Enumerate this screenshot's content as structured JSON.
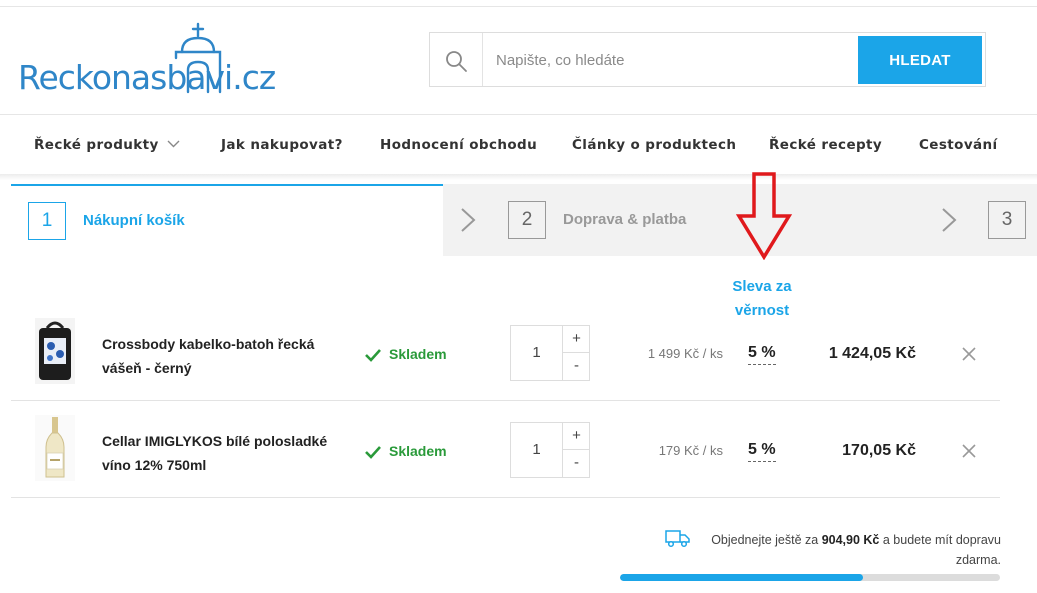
{
  "header": {
    "logo_text": "Reckonasbavi.cz",
    "search": {
      "placeholder": "Napište, co hledáte",
      "button_label": "HLEDAT"
    }
  },
  "nav": {
    "items": [
      {
        "label": "Řecké produkty",
        "has_dropdown": true
      },
      {
        "label": "Jak nakupovat?"
      },
      {
        "label": "Hodnocení obchodu"
      },
      {
        "label": "Články o produktech"
      },
      {
        "label": "Řecké recepty"
      },
      {
        "label": "Cestování"
      }
    ]
  },
  "steps": [
    {
      "number": "1",
      "label": "Nákupní košík",
      "active": true
    },
    {
      "number": "2",
      "label": "Doprava & platba",
      "active": false
    },
    {
      "number": "3",
      "label": "",
      "active": false
    }
  ],
  "cart": {
    "loyalty_header_line1": "Sleva za",
    "loyalty_header_line2": "věrnost",
    "items": [
      {
        "name": "Crossbody kabelko-batoh řecká vášeň - černý",
        "stock": "Skladem",
        "quantity": "1",
        "unit_price": "1 499 Kč / ks",
        "discount": "5 %",
        "total": "1 424,05 Kč",
        "thumb_icon": "handbag-icon"
      },
      {
        "name": "Cellar IMIGLYKOS bílé polosladké víno 12% 750ml",
        "stock": "Skladem",
        "quantity": "1",
        "unit_price": "179 Kč / ks",
        "discount": "5 %",
        "total": "170,05 Kč",
        "thumb_icon": "wine-bottle-icon"
      }
    ],
    "qty_plus": "+",
    "qty_minus": "-"
  },
  "shipping": {
    "text_before": "Objednejte ještě za",
    "amount": "904,90 Kč",
    "text_after": "a budete mít dopravu zdarma.",
    "progress_fraction": 0.64
  },
  "colors": {
    "accent": "#1ba5e8",
    "stock": "#2a9a3a",
    "annotation": "#e0191c"
  }
}
